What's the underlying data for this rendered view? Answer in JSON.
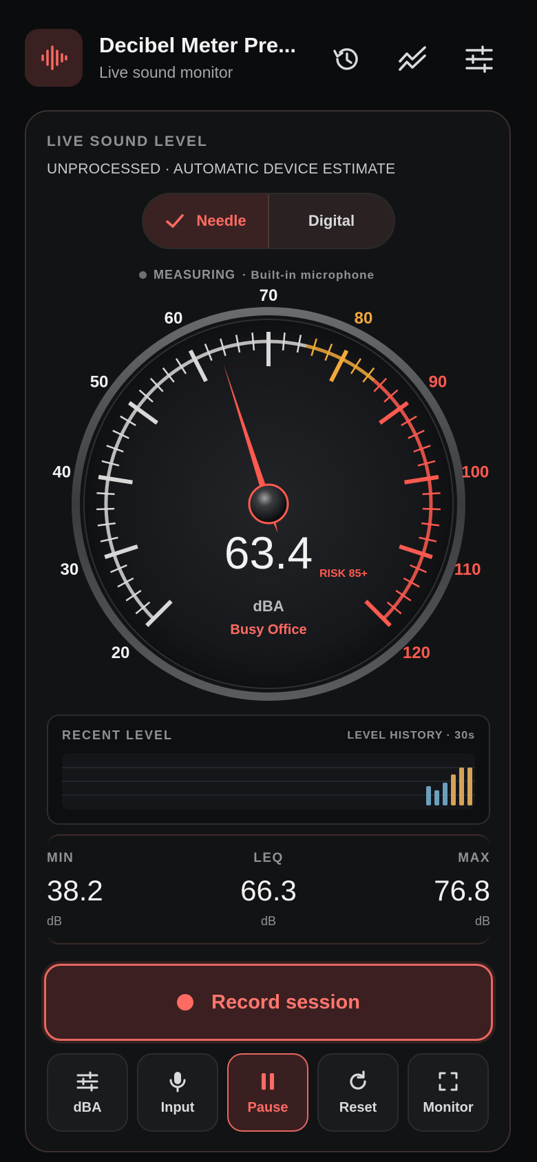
{
  "header": {
    "title": "Decibel Meter Pre...",
    "subtitle": "Live sound monitor",
    "icons": [
      "sound-wave-icon",
      "history-icon",
      "trend-icon",
      "sliders-icon"
    ]
  },
  "card": {
    "live_label": "LIVE SOUND LEVEL",
    "processing": "UNPROCESSED · AUTOMATIC DEVICE ESTIMATE",
    "segment": {
      "needle_label": "Needle",
      "digital_label": "Digital",
      "selected": "Needle"
    },
    "status": {
      "state": "MEASURING",
      "source": "· Built-in microphone"
    }
  },
  "gauge": {
    "value": "63.4",
    "value_num": 63.4,
    "unit": "dBA",
    "risk_label": "RISK 85+",
    "environment": "Busy Office",
    "scale": {
      "min": 20,
      "max": 120,
      "labels": [
        "20",
        "30",
        "40",
        "50",
        "60",
        "70",
        "80",
        "90",
        "100",
        "110",
        "120"
      ],
      "warn_from": 75,
      "danger_from": 85
    },
    "colors": {
      "normal": "#d8d8d8",
      "warn": "#f2a93b",
      "danger": "#ff5a4f",
      "needle": "#ff5a4f"
    }
  },
  "recent": {
    "label": "RECENT LEVEL",
    "history_label": "LEVEL HISTORY · 30s",
    "bars": [
      {
        "level": 0.42,
        "color": "#6c9fbd"
      },
      {
        "level": 0.34,
        "color": "#6c9fbd"
      },
      {
        "level": 0.48,
        "color": "#6c9fbd"
      },
      {
        "level": 0.62,
        "color": "#d5a257"
      },
      {
        "level": 0.74,
        "color": "#d5a257"
      },
      {
        "level": 0.74,
        "color": "#d5a257"
      }
    ]
  },
  "stats": [
    {
      "label": "MIN",
      "value": "38.2",
      "unit": "dB"
    },
    {
      "label": "LEQ",
      "value": "66.3",
      "unit": "dB"
    },
    {
      "label": "MAX",
      "value": "76.8",
      "unit": "dB"
    }
  ],
  "record": {
    "label": "Record session"
  },
  "controls": [
    {
      "label": "dBA",
      "icon": "sliders-icon"
    },
    {
      "label": "Input",
      "icon": "microphone-icon"
    },
    {
      "label": "Pause",
      "icon": "pause-icon",
      "active": true
    },
    {
      "label": "Reset",
      "icon": "refresh-icon"
    },
    {
      "label": "Monitor",
      "icon": "fullscreen-icon"
    }
  ]
}
